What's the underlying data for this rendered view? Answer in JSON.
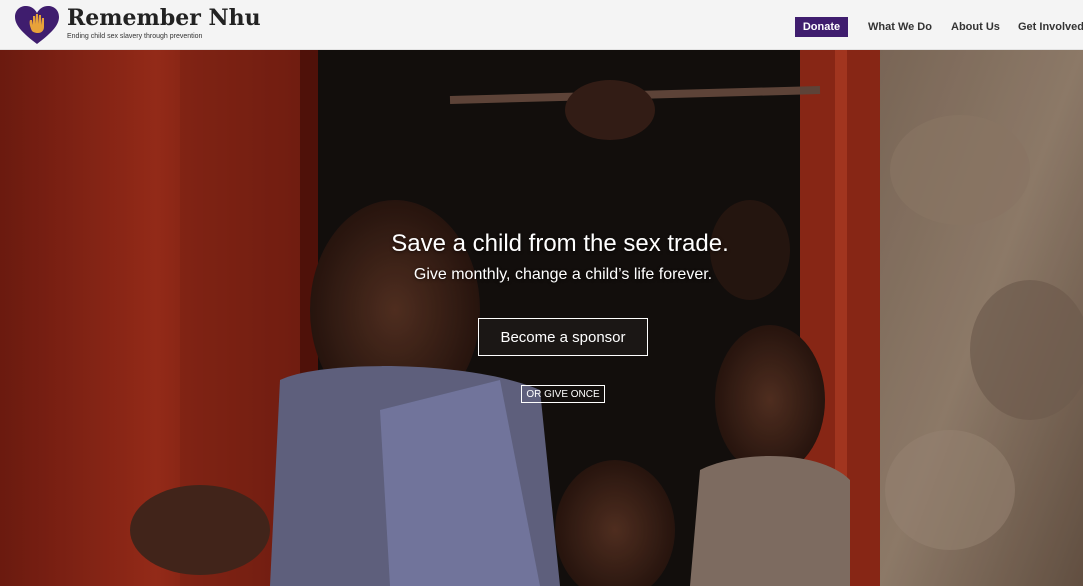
{
  "brand": {
    "name": "Remember Nhu",
    "tagline": "Ending child sex slavery through prevention",
    "logo_color": "#3f1d6e",
    "hand_color": "#e8a23a"
  },
  "nav": {
    "donate_label": "Donate",
    "items": [
      "What We Do",
      "About Us",
      "Get Involved"
    ],
    "accent": "#3f1d6e"
  },
  "hero": {
    "title": "Save a child from the sex trade.",
    "subtitle": "Give monthly, change a child’s life forever.",
    "primary_cta": "Become a sponsor",
    "secondary_cta": "OR GIVE ONCE"
  }
}
